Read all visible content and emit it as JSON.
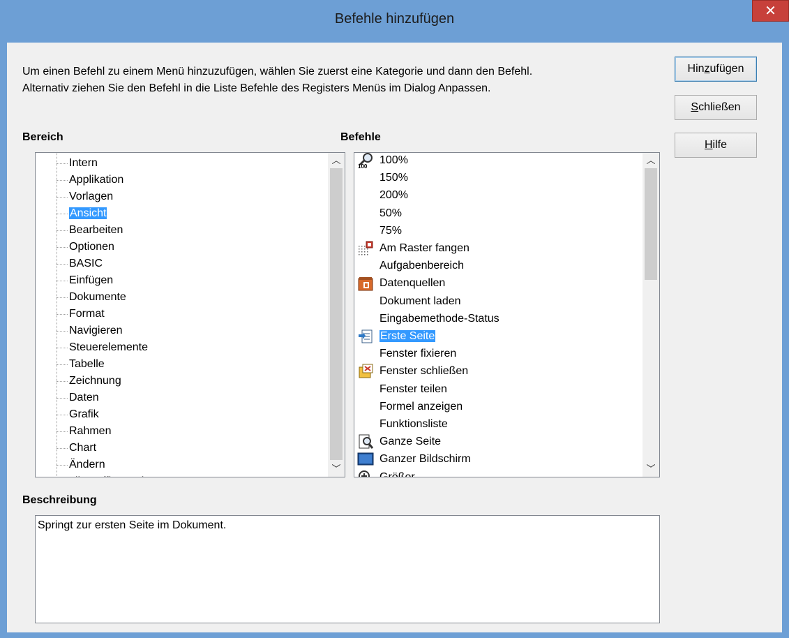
{
  "window": {
    "title": "Befehle hinzufügen",
    "close_glyph": "✕"
  },
  "intro": {
    "line1": "Um einen Befehl zu einem Menü hinzuzufügen, wählen Sie zuerst eine Kategorie und dann den Befehl.",
    "line2": "Alternativ ziehen Sie den Befehl in die Liste Befehle des Registers Menüs im Dialog Anpassen."
  },
  "bereich": {
    "label": "Bereich",
    "items": [
      "Intern",
      "Applikation",
      "Vorlagen",
      "Ansicht",
      "Bearbeiten",
      "Optionen",
      "BASIC",
      "Einfügen",
      "Dokumente",
      "Format",
      "Navigieren",
      "Steuerelemente",
      "Tabelle",
      "Zeichnung",
      "Daten",
      "Grafik",
      "Rahmen",
      "Chart",
      "Ändern"
    ],
    "selected": "Ansicht",
    "macros_item": "LibreOffice Makros",
    "expander_glyph": "+"
  },
  "befehle": {
    "label": "Befehle",
    "items": [
      {
        "label": "100%",
        "icon": "zoom-100-icon"
      },
      {
        "label": "150%",
        "icon": ""
      },
      {
        "label": "200%",
        "icon": ""
      },
      {
        "label": "50%",
        "icon": ""
      },
      {
        "label": "75%",
        "icon": ""
      },
      {
        "label": "Am Raster fangen",
        "icon": "snap-grid-icon"
      },
      {
        "label": "Aufgabenbereich",
        "icon": ""
      },
      {
        "label": "Datenquellen",
        "icon": "data-sources-icon"
      },
      {
        "label": "Dokument laden",
        "icon": ""
      },
      {
        "label": "Eingabemethode-Status",
        "icon": ""
      },
      {
        "label": "Erste Seite",
        "icon": "first-page-icon"
      },
      {
        "label": "Fenster fixieren",
        "icon": ""
      },
      {
        "label": "Fenster schließen",
        "icon": "close-window-icon"
      },
      {
        "label": "Fenster teilen",
        "icon": ""
      },
      {
        "label": "Formel anzeigen",
        "icon": ""
      },
      {
        "label": "Funktionsliste",
        "icon": ""
      },
      {
        "label": "Ganze Seite",
        "icon": "whole-page-icon"
      },
      {
        "label": "Ganzer Bildschirm",
        "icon": "full-screen-icon"
      },
      {
        "label": "Größer",
        "icon": "zoom-in-icon"
      }
    ],
    "selected": "Erste Seite"
  },
  "beschreibung": {
    "label": "Beschreibung",
    "text": "Springt zur ersten Seite im Dokument."
  },
  "buttons": {
    "add_pre": "Hin",
    "add_acc": "z",
    "add_post": "ufügen",
    "close_acc": "S",
    "close_post": "chließen",
    "help_acc": "H",
    "help_post": "ilfe"
  },
  "scroll": {
    "up_glyph": "︿",
    "down_glyph": "﹀"
  },
  "colors": {
    "selection": "#3399ff",
    "titlebar": "#6d9fd5",
    "close_button": "#c7403a"
  }
}
